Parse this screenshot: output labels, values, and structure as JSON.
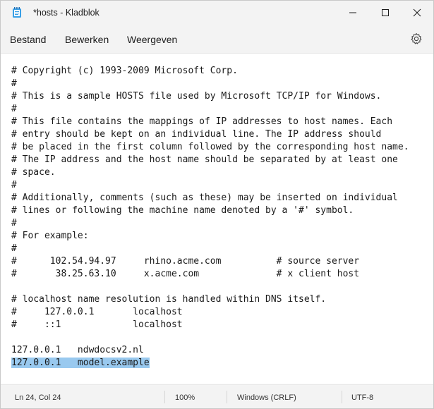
{
  "window": {
    "title": "*hosts - Kladblok",
    "icon": "notepad-icon"
  },
  "menu": [
    "Bestand",
    "Bewerken",
    "Weergeven"
  ],
  "editor": {
    "lines": [
      "# Copyright (c) 1993-2009 Microsoft Corp.",
      "#",
      "# This is a sample HOSTS file used by Microsoft TCP/IP for Windows.",
      "#",
      "# This file contains the mappings of IP addresses to host names. Each",
      "# entry should be kept on an individual line. The IP address should",
      "# be placed in the first column followed by the corresponding host name.",
      "# The IP address and the host name should be separated by at least one",
      "# space.",
      "#",
      "# Additionally, comments (such as these) may be inserted on individual",
      "# lines or following the machine name denoted by a '#' symbol.",
      "#",
      "# For example:",
      "#",
      "#      102.54.94.97     rhino.acme.com          # source server",
      "#       38.25.63.10     x.acme.com              # x client host",
      "",
      "# localhost name resolution is handled within DNS itself.",
      "#     127.0.0.1       localhost",
      "#     ::1             localhost",
      "",
      "127.0.0.1   ndwdocsv2.nl",
      "127.0.0.1   model.example"
    ],
    "selected_line": 23
  },
  "status": {
    "position": "Ln 24, Col 24",
    "zoom": "100%",
    "line_ending": "Windows (CRLF)",
    "encoding": "UTF-8"
  },
  "colors": {
    "selection": "#99c9ef",
    "titlebar": "#f3f3f3",
    "editor_bg": "#ffffff"
  }
}
